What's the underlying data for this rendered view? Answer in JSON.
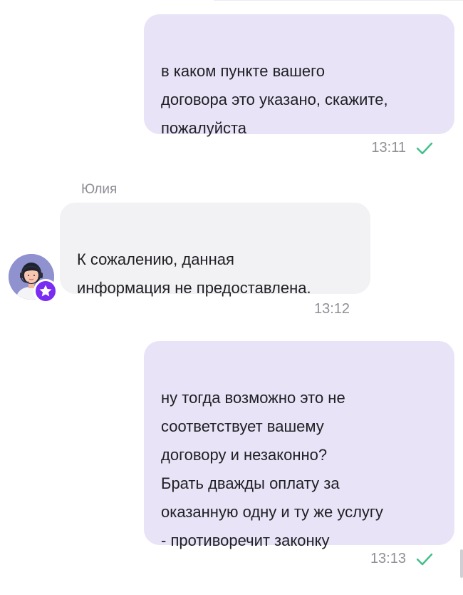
{
  "messages": [
    {
      "direction": "outgoing",
      "text": "в каком пункте вашего\nдоговора это указано, скажите,\nпожалуйста",
      "time": "13:11",
      "status": "check-icon"
    },
    {
      "direction": "incoming",
      "sender": "Юлия",
      "text": "К сожалению, данная\nинформация не предоставлена.",
      "time": "13:12"
    },
    {
      "direction": "outgoing",
      "text": "ну тогда возможно это не\nсоответствует вашему\nдоговору и незаконно?\nБрать дважды оплату за\nоказанную одну и ту же услугу\n- противоречит законку",
      "time": "13:13",
      "status": "check-icon"
    }
  ],
  "colors": {
    "outgoing_bubble": "#e8e3f7",
    "incoming_bubble": "#f2f2f4",
    "check": "#3fbf8a",
    "badge": "#7a2cf2"
  }
}
